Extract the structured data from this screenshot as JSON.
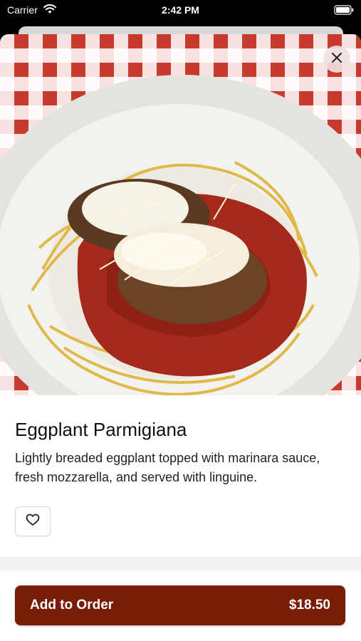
{
  "status_bar": {
    "carrier": "Carrier",
    "time": "2:42 PM"
  },
  "item": {
    "name": "Eggplant Parmigiana",
    "description": "Lightly breaded eggplant topped with marinara sauce, fresh mozzarella, and served with linguine."
  },
  "order": {
    "add_label": "Add to Order",
    "price": "$18.50"
  },
  "icons": {
    "close": "close-icon",
    "favorite": "heart-icon",
    "wifi": "wifi-icon",
    "battery": "battery-icon"
  },
  "colors": {
    "accent": "#7a1d08"
  }
}
